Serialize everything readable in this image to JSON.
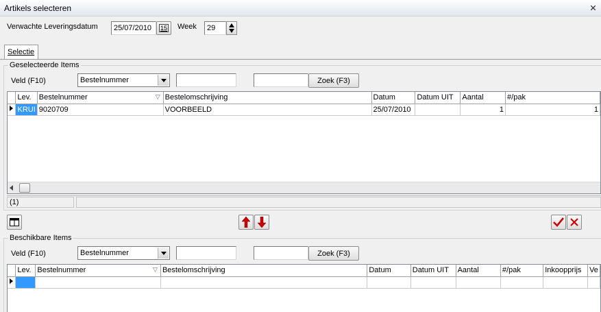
{
  "window": {
    "title": "Artikels selecteren"
  },
  "header": {
    "delivery_label": "Verwachte Leveringsdatum",
    "delivery_value": "25/07/2010",
    "calendar_label": "15",
    "week_label": "Week",
    "week_value": "29"
  },
  "tabs": [
    {
      "label": "Selectie"
    }
  ],
  "selected": {
    "group_title": "Geselecteerde Items",
    "field_label": "Veld (F10)",
    "field_value": "Bestelnummer",
    "search_value": "",
    "search_value2": "",
    "search_button": "Zoek (F3)",
    "columns": [
      "Lev.",
      "Bestelnummer",
      "Bestelomschrijving",
      "Datum",
      "Datum UIT",
      "Aantal",
      "#/pak"
    ],
    "rows": [
      {
        "lev": "KRUI",
        "bestelnummer": "9020709",
        "omschrijving": "VOORBEELD",
        "datum": "25/07/2010",
        "datum_uit": "",
        "aantal": "1",
        "pak": "1"
      }
    ],
    "status_count": "(1)"
  },
  "available": {
    "group_title": "Beschikbare Items",
    "field_label": "Veld (F10)",
    "field_value": "Bestelnummer",
    "search_value": "",
    "search_value2": "",
    "search_button": "Zoek (F3)",
    "columns": [
      "Lev.",
      "Bestelnummer",
      "Bestelomschrijving",
      "Datum",
      "Datum UIT",
      "Aantal",
      "#/pak",
      "Inkoopprijs",
      "Ve"
    ]
  },
  "colors": {
    "accent_red": "#cc0000",
    "selection": "#3399ff"
  }
}
